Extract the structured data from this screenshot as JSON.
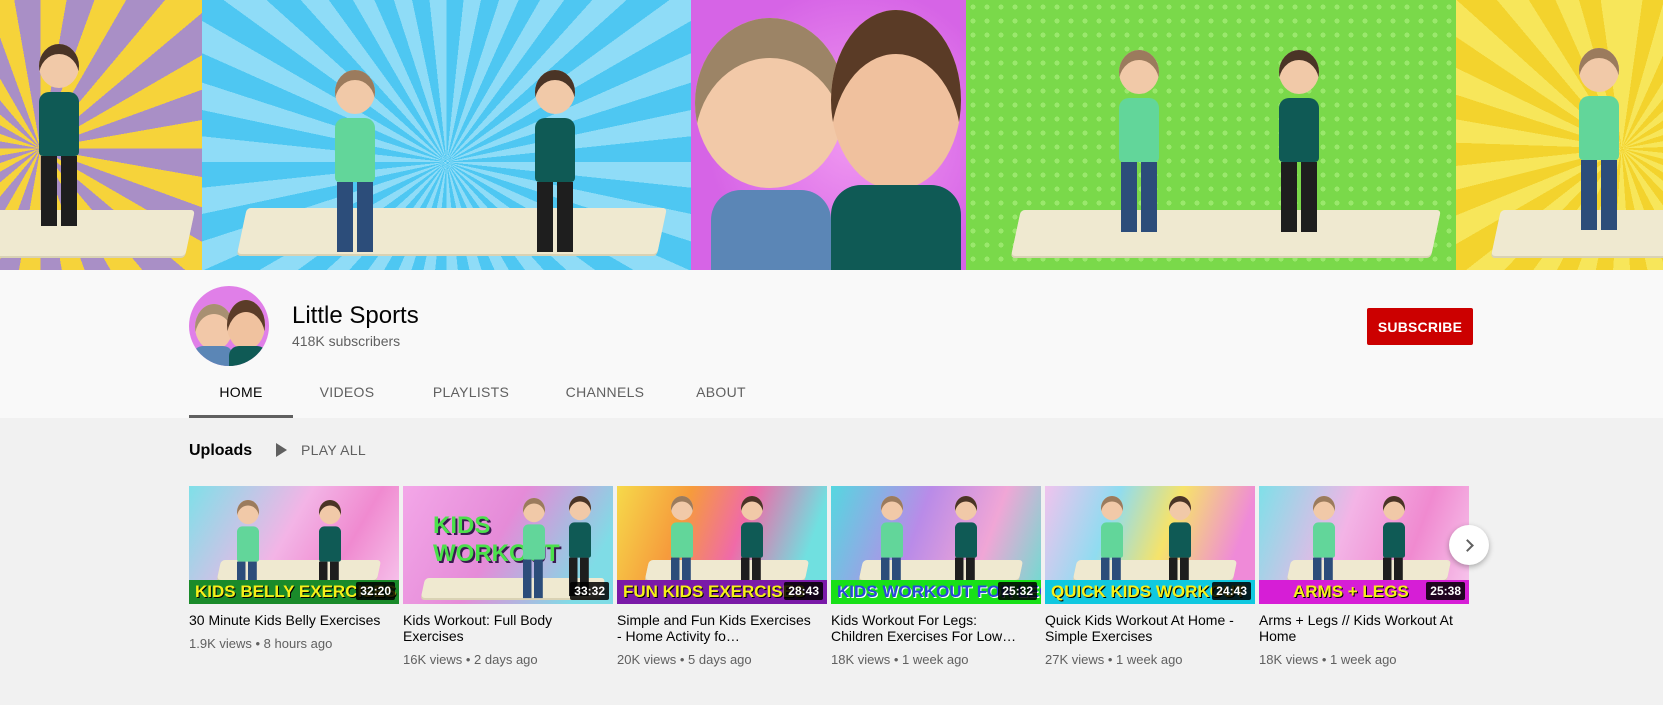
{
  "channel": {
    "name": "Little Sports",
    "subscribers": "418K subscribers",
    "subscribe_label": "SUBSCRIBE"
  },
  "tabs": [
    {
      "label": "HOME",
      "active": true
    },
    {
      "label": "VIDEOS",
      "active": false
    },
    {
      "label": "PLAYLISTS",
      "active": false
    },
    {
      "label": "CHANNELS",
      "active": false
    },
    {
      "label": "ABOUT",
      "active": false
    }
  ],
  "shelf": {
    "title": "Uploads",
    "play_all": "PLAY ALL",
    "next_icon": "chevron-right-icon"
  },
  "videos": [
    {
      "thumb_text": "KIDS BELLY EXERCISES",
      "duration": "32:20",
      "title": "30 Minute Kids Belly Exercises",
      "views": "1.9K views",
      "age": "8 hours ago"
    },
    {
      "thumb_text": "KIDS WORKOUT",
      "duration": "33:32",
      "title": "Kids Workout: Full Body Exercises",
      "views": "16K views",
      "age": "2 days ago"
    },
    {
      "thumb_text": "FUN KIDS EXERCISES",
      "duration": "28:43",
      "title": "Simple and Fun Kids Exercises - Home Activity fo…",
      "views": "20K views",
      "age": "5 days ago"
    },
    {
      "thumb_text": "KIDS WORKOUT FOR LEGS",
      "duration": "25:32",
      "title": "Kids Workout For Legs: Children Exercises For Low…",
      "views": "18K views",
      "age": "1 week ago"
    },
    {
      "thumb_text": "QUICK KIDS WORKOUT",
      "duration": "24:43",
      "title": "Quick Kids Workout At Home - Simple Exercises",
      "views": "27K views",
      "age": "1 week ago"
    },
    {
      "thumb_text": "ARMS + LEGS",
      "duration": "25:38",
      "title": "Arms + Legs // Kids Workout At Home",
      "views": "18K views",
      "age": "1 week ago"
    }
  ],
  "colors": {
    "subscribe": "#cc0000",
    "text_primary": "#030303",
    "text_secondary": "#606060",
    "page_bg": "#f1f1f1",
    "header_bg": "#f9f9f9"
  }
}
